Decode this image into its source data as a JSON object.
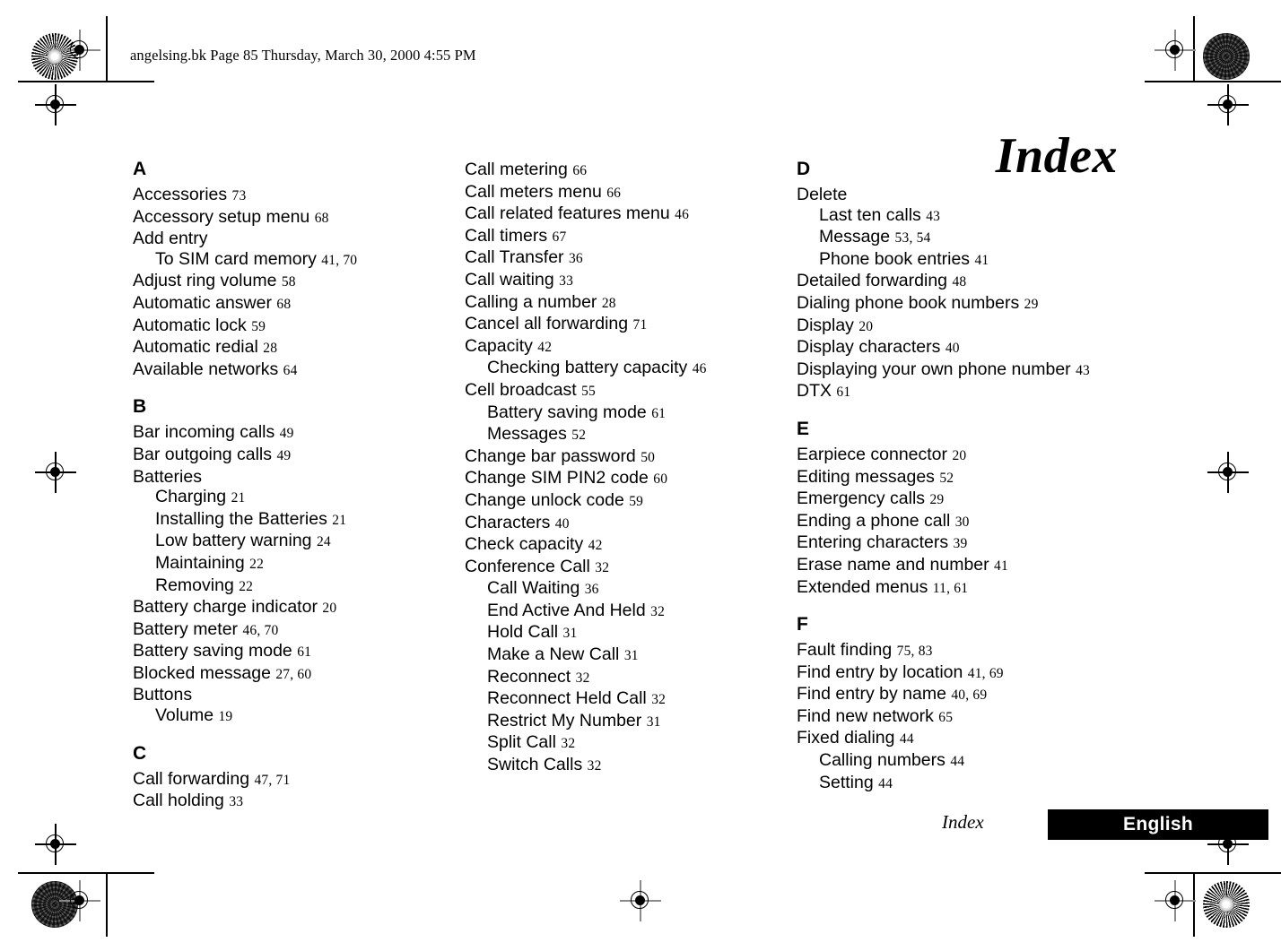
{
  "page_header": "angelsing.bk  Page 85  Thursday, March 30, 2000  4:55 PM",
  "title": "Index",
  "footer": {
    "section_label": "Index",
    "language_label": "English"
  },
  "columns": [
    {
      "sections": [
        {
          "letter": "A",
          "entries": [
            {
              "text": "Accessories",
              "pages": "73",
              "sub": false
            },
            {
              "text": "Accessory setup menu",
              "pages": "68",
              "sub": false
            },
            {
              "text": "Add entry",
              "pages": "",
              "sub": false
            },
            {
              "text": "To SIM card memory",
              "pages": "41, 70",
              "sub": true
            },
            {
              "text": "Adjust ring volume",
              "pages": "58",
              "sub": false
            },
            {
              "text": "Automatic answer",
              "pages": "68",
              "sub": false
            },
            {
              "text": "Automatic lock",
              "pages": "59",
              "sub": false
            },
            {
              "text": "Automatic redial",
              "pages": "28",
              "sub": false
            },
            {
              "text": "Available networks",
              "pages": "64",
              "sub": false
            }
          ]
        },
        {
          "letter": "B",
          "entries": [
            {
              "text": "Bar incoming calls",
              "pages": "49",
              "sub": false
            },
            {
              "text": "Bar outgoing calls",
              "pages": "49",
              "sub": false
            },
            {
              "text": "Batteries",
              "pages": "",
              "sub": false
            },
            {
              "text": "Charging",
              "pages": "21",
              "sub": true
            },
            {
              "text": "Installing the Batteries",
              "pages": "21",
              "sub": true
            },
            {
              "text": "Low battery warning",
              "pages": "24",
              "sub": true
            },
            {
              "text": "Maintaining",
              "pages": "22",
              "sub": true
            },
            {
              "text": "Removing",
              "pages": "22",
              "sub": true
            },
            {
              "text": "Battery charge indicator",
              "pages": "20",
              "sub": false
            },
            {
              "text": "Battery meter",
              "pages": "46, 70",
              "sub": false
            },
            {
              "text": "Battery saving mode",
              "pages": "61",
              "sub": false
            },
            {
              "text": "Blocked message",
              "pages": "27, 60",
              "sub": false
            },
            {
              "text": "Buttons",
              "pages": "",
              "sub": false
            },
            {
              "text": "Volume",
              "pages": "19",
              "sub": true
            }
          ]
        },
        {
          "letter": "C",
          "entries": [
            {
              "text": "Call forwarding",
              "pages": "47, 71",
              "sub": false
            },
            {
              "text": "Call holding",
              "pages": "33",
              "sub": false
            }
          ]
        }
      ]
    },
    {
      "sections": [
        {
          "letter": "",
          "entries": [
            {
              "text": "Call metering",
              "pages": "66",
              "sub": false
            },
            {
              "text": "Call meters menu",
              "pages": "66",
              "sub": false
            },
            {
              "text": "Call related features menu",
              "pages": "46",
              "sub": false
            },
            {
              "text": "Call timers",
              "pages": "67",
              "sub": false
            },
            {
              "text": "Call Transfer",
              "pages": "36",
              "sub": false
            },
            {
              "text": "Call waiting",
              "pages": "33",
              "sub": false
            },
            {
              "text": "Calling a number",
              "pages": "28",
              "sub": false
            },
            {
              "text": "Cancel all forwarding",
              "pages": "71",
              "sub": false
            },
            {
              "text": "Capacity",
              "pages": "42",
              "sub": false
            },
            {
              "text": "Checking battery capacity",
              "pages": "46",
              "sub": true
            },
            {
              "text": "Cell broadcast",
              "pages": "55",
              "sub": false
            },
            {
              "text": "Battery saving mode",
              "pages": "61",
              "sub": true
            },
            {
              "text": "Messages",
              "pages": "52",
              "sub": true
            },
            {
              "text": "Change bar password",
              "pages": "50",
              "sub": false
            },
            {
              "text": "Change SIM PIN2 code",
              "pages": "60",
              "sub": false
            },
            {
              "text": "Change unlock code",
              "pages": "59",
              "sub": false
            },
            {
              "text": "Characters",
              "pages": "40",
              "sub": false
            },
            {
              "text": "Check capacity",
              "pages": "42",
              "sub": false
            },
            {
              "text": "Conference Call",
              "pages": "32",
              "sub": false
            },
            {
              "text": "Call Waiting",
              "pages": "36",
              "sub": true
            },
            {
              "text": "End Active And Held",
              "pages": "32",
              "sub": true
            },
            {
              "text": "Hold Call",
              "pages": "31",
              "sub": true
            },
            {
              "text": "Make a New Call",
              "pages": "31",
              "sub": true
            },
            {
              "text": "Reconnect",
              "pages": "32",
              "sub": true
            },
            {
              "text": "Reconnect Held Call",
              "pages": "32",
              "sub": true
            },
            {
              "text": "Restrict My Number",
              "pages": "31",
              "sub": true
            },
            {
              "text": "Split Call",
              "pages": "32",
              "sub": true
            },
            {
              "text": "Switch Calls",
              "pages": "32",
              "sub": true
            }
          ]
        }
      ]
    },
    {
      "sections": [
        {
          "letter": "D",
          "entries": [
            {
              "text": "Delete",
              "pages": "",
              "sub": false
            },
            {
              "text": "Last ten calls",
              "pages": "43",
              "sub": true
            },
            {
              "text": "Message",
              "pages": "53, 54",
              "sub": true
            },
            {
              "text": "Phone book entries",
              "pages": "41",
              "sub": true
            },
            {
              "text": "Detailed forwarding",
              "pages": "48",
              "sub": false
            },
            {
              "text": "Dialing phone book numbers",
              "pages": "29",
              "sub": false
            },
            {
              "text": "Display",
              "pages": "20",
              "sub": false
            },
            {
              "text": "Display characters",
              "pages": "40",
              "sub": false
            },
            {
              "text": "Displaying your own phone number",
              "pages": "43",
              "sub": false
            },
            {
              "text": "DTX",
              "pages": "61",
              "sub": false
            }
          ]
        },
        {
          "letter": "E",
          "entries": [
            {
              "text": "Earpiece connector",
              "pages": "20",
              "sub": false
            },
            {
              "text": "Editing messages",
              "pages": "52",
              "sub": false
            },
            {
              "text": "Emergency calls",
              "pages": "29",
              "sub": false
            },
            {
              "text": "Ending a phone call",
              "pages": "30",
              "sub": false
            },
            {
              "text": "Entering characters",
              "pages": "39",
              "sub": false
            },
            {
              "text": "Erase name and number",
              "pages": "41",
              "sub": false
            },
            {
              "text": "Extended menus",
              "pages": "11, 61",
              "sub": false
            }
          ]
        },
        {
          "letter": "F",
          "entries": [
            {
              "text": "Fault finding",
              "pages": "75, 83",
              "sub": false
            },
            {
              "text": "Find entry by location",
              "pages": "41, 69",
              "sub": false
            },
            {
              "text": "Find entry by name",
              "pages": "40, 69",
              "sub": false
            },
            {
              "text": "Find new network",
              "pages": "65",
              "sub": false
            },
            {
              "text": "Fixed dialing",
              "pages": "44",
              "sub": false
            },
            {
              "text": "Calling numbers",
              "pages": "44",
              "sub": true
            },
            {
              "text": "Setting",
              "pages": "44",
              "sub": true
            }
          ]
        }
      ]
    }
  ]
}
